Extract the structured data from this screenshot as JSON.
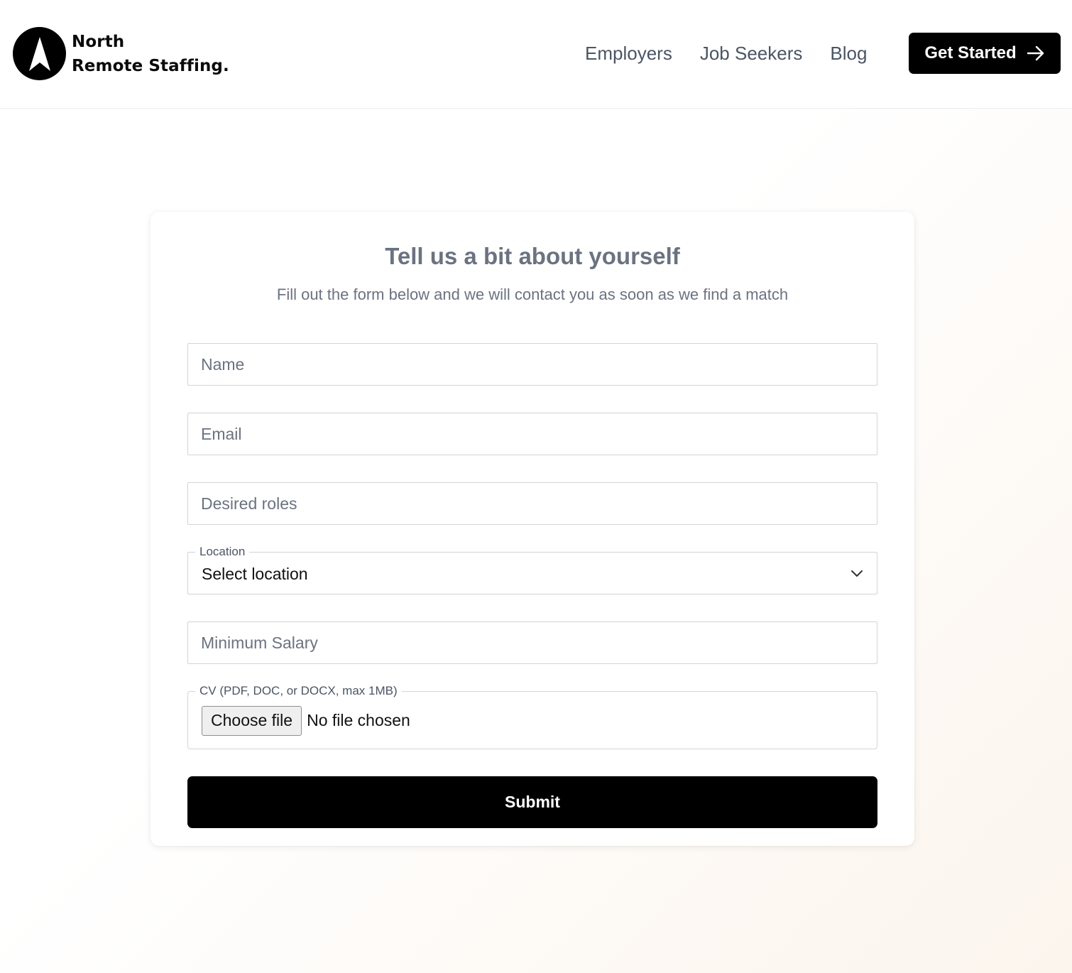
{
  "header": {
    "brand": {
      "line1": "North",
      "line2": "Remote Staffing."
    },
    "nav": [
      {
        "label": "Employers"
      },
      {
        "label": "Job Seekers"
      },
      {
        "label": "Blog"
      }
    ],
    "cta": {
      "label": "Get Started",
      "icon": "arrow-right-icon"
    }
  },
  "form": {
    "title": "Tell us a bit about yourself",
    "subtitle": "Fill out the form below and we will contact you as soon as we find a match",
    "name": {
      "placeholder": "Name",
      "value": ""
    },
    "email": {
      "placeholder": "Email",
      "value": ""
    },
    "desired_roles": {
      "placeholder": "Desired roles",
      "value": ""
    },
    "location": {
      "label": "Location",
      "selected": "Select location",
      "icon": "chevron-down-icon"
    },
    "minimum_salary": {
      "placeholder": "Minimum Salary",
      "value": ""
    },
    "cv": {
      "label": "CV (PDF, DOC, or DOCX, max 1MB)",
      "button_label": "Choose file",
      "status": "No file chosen"
    },
    "submit_label": "Submit"
  },
  "colors": {
    "primary": "#000000",
    "muted_text": "#6b7280",
    "nav_text": "#4b5563",
    "border": "#d4d4d8"
  }
}
